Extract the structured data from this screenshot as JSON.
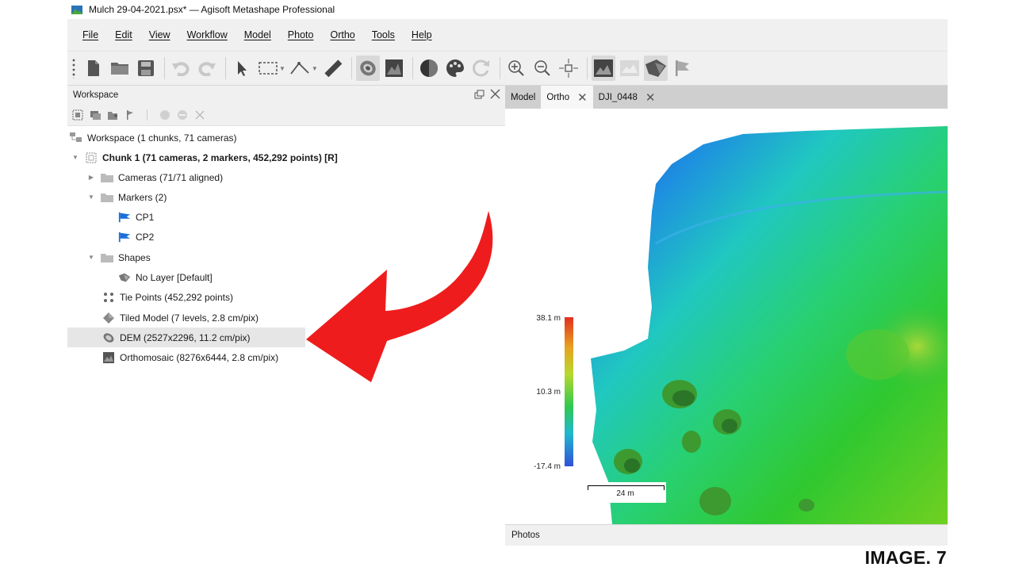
{
  "window": {
    "title": "Mulch 29-04-2021.psx* — Agisoft Metashape Professional"
  },
  "menu": [
    "File",
    "Edit",
    "View",
    "Workflow",
    "Model",
    "Photo",
    "Ortho",
    "Tools",
    "Help"
  ],
  "workspace": {
    "header": "Workspace",
    "tree": {
      "root": "Workspace (1 chunks, 71 cameras)",
      "chunk": "Chunk 1 (71 cameras, 2 markers, 452,292 points) [R]",
      "cameras": "Cameras (71/71 aligned)",
      "markers": "Markers (2)",
      "cp1": "CP1",
      "cp2": "CP2",
      "shapes": "Shapes",
      "no_layer": "No Layer [Default]",
      "tie_points": "Tie Points (452,292 points)",
      "tiled_model": "Tiled Model (7 levels, 2.8 cm/pix)",
      "dem": "DEM (2527x2296, 11.2 cm/pix)",
      "ortho": "Orthomosaic (8276x6444, 2.8 cm/pix)"
    }
  },
  "tabs": [
    {
      "label": "Model"
    },
    {
      "label": "Ortho"
    },
    {
      "label": "DJI_0448"
    }
  ],
  "legend": {
    "max": "38.1 m",
    "mid": "10.3 m",
    "min": "-17.4 m"
  },
  "scale": {
    "label": "24 m"
  },
  "photos_panel": "Photos",
  "caption": "IMAGE. 7",
  "colors": {
    "arrow": "#ee1c1c",
    "toolbar_bg": "#f0f0f0",
    "tab_bg": "#cfcfcf"
  }
}
